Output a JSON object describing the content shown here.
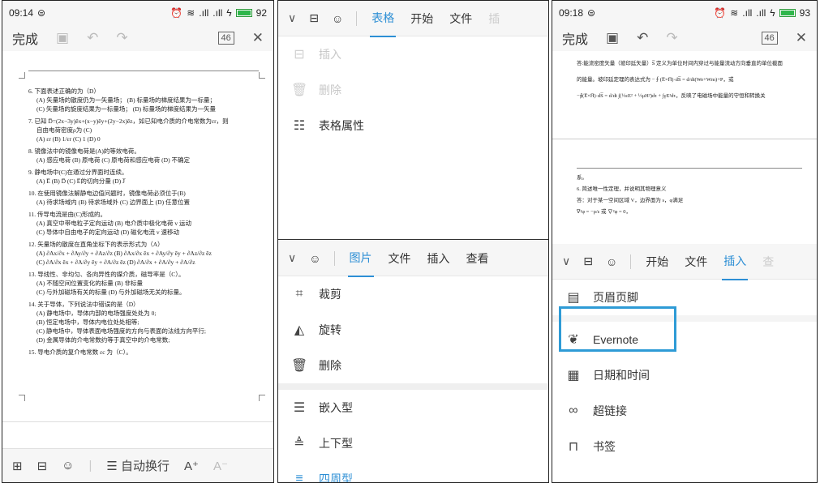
{
  "panel1": {
    "status": {
      "time": "09:14",
      "battery": "92",
      "battery_level": 0.92
    },
    "toolbar": {
      "done": "完成",
      "pages_badge": "46"
    },
    "doc": {
      "questions": [
        {
          "stem": "6. 下面表述正确的为（D）",
          "options": [
            "(A) 矢量场的散度仍为一矢量场；  (B) 标量场的梯度结果为一标量；",
            "(C) 矢量场的旋度结果为一标量场；  (D) 标量场的梯度结果为一矢量"
          ]
        },
        {
          "stem": "7. 已知 D̅=(2x−3y)ēx+(x−y)ēy+(2y−2x)ēz，如已知电介质的介电常数为εr，则",
          "options": [
            "自由电荷密度ρ为 (C)",
            "(A) εr      (B) 1/εr      (C) 1      (D) 0"
          ]
        },
        {
          "stem": "8. 镜像法中的镜像电荷是(A)的等效电荷。",
          "options": [
            "(A) 感应电荷   (B) 原电荷   (C) 原电荷和感应电荷   (D) 不确定"
          ]
        },
        {
          "stem": "9. 静电场中(C)在通过分界面时连续。",
          "options": [
            "(A) E̅     (B) D̅     (C) E̅的切向分量     (D) J̅"
          ]
        },
        {
          "stem": "10. 在使用镜像法解静电边值问题时，镜像电荷必须位于(B)",
          "options": [
            "(A) 待求场域内   (B) 待求场域外   (C) 边界面上   (D) 任意位置"
          ]
        },
        {
          "stem": "11. 传导电流是由(C)形成的。",
          "options": [
            "(A) 真空中带电粒子定向运动   (B) 电介质中极化电荷 v 运动",
            "(C) 导体中自由电子的定向运动   (D) 磁化电流 v 速移动"
          ]
        },
        {
          "stem": "12. 矢量场的散度在直角坐标下的表示形式为（A）",
          "options": [
            "(A) ∂Ax/∂x + ∂Ay/∂y + ∂Az/∂z      (B) ∂Ax/∂x ēx + ∂Ay/∂y ēy + ∂Az/∂z ēz",
            "(C) ∂A/∂x ēx + ∂A/∂y ēy + ∂A/∂z ēz      (D) ∂A/∂x + ∂A/∂y + ∂A/∂z"
          ]
        },
        {
          "stem": "13. 导线性、非均匀、各向异性的媒介质，磁导率是（C）。",
          "options": [
            "(A) 不随空间位置变化的标量      (B) 非标量",
            "(C) 与外加磁场有关的标量      (D) 与外加磁场无关的标量。"
          ]
        },
        {
          "stem": "14. 关于导体，下列说法中错误的是（D）",
          "options": [
            "(A) 静电场中，导体内部的电场强度处处为 0;",
            "(B) 恒定电场中，导体内电位处处相等;",
            "(C) 静电场中，导体表面电场强度的方向与表面的法线方向平行;",
            "(D) 金属导体的介电常数约等于真空中的介电常数;"
          ]
        },
        {
          "stem": "15. 导电介质的复介电常数 εc 为（C）。",
          "options": []
        }
      ]
    },
    "bottombar": {
      "wrap": "自动换行",
      "font_up": "A⁺",
      "font_down": "A⁻"
    }
  },
  "panel2": {
    "tabs_top": [
      "表格",
      "开始",
      "文件"
    ],
    "menu_top": [
      {
        "icon": "insert-icon",
        "label": "插入",
        "disabled": true
      },
      {
        "icon": "trash-icon",
        "label": "删除",
        "disabled": true
      },
      {
        "icon": "table-properties-icon",
        "label": "表格属性",
        "disabled": false
      }
    ],
    "tabs_bottom": [
      "图片",
      "文件",
      "插入",
      "查看"
    ],
    "menu_bottom": [
      {
        "icon": "crop-icon",
        "label": "裁剪"
      },
      {
        "icon": "rotate-icon",
        "label": "旋转"
      },
      {
        "icon": "trash-icon",
        "label": "删除"
      }
    ],
    "menu_wrap": [
      {
        "icon": "inline-icon",
        "label": "嵌入型"
      },
      {
        "icon": "top-bottom-icon",
        "label": "上下型"
      },
      {
        "icon": "square-wrap-icon",
        "label": "四周型"
      }
    ]
  },
  "panel3": {
    "status": {
      "time": "09:18",
      "battery": "93",
      "battery_level": 0.93
    },
    "toolbar": {
      "done": "完成",
      "pages_badge": "46"
    },
    "doc_lines": [
      "答:能流密度矢量（坡印廷矢量）S̅ 定义为单位时间内穿过与能量流动方向垂直的单位截面",
      "的能量。坡印廷定理的表达式为 −∮(E̅×H̅)·dS̅ = d/dt(We+Wm)+P，或",
      "−∮(E̅×H̅)·dS̅ = d/dt ∫(½εE² + ½μH²)dτ + ∫γE²dτ，反映了电磁场中能量的守恒和转换关"
    ],
    "doc_lines_2": [
      "系。",
      "6. 简述唯一性定理，并说明其物理意义",
      "答：对于某一空间区域 V，边界面为 s，φ满足",
      "∇²φ = −ρ/ε   或   ∇²φ = 0，"
    ],
    "tabs": [
      "开始",
      "文件",
      "插入"
    ],
    "menu": [
      {
        "icon": "header-footer-icon",
        "label": "页眉页脚"
      },
      {
        "icon": "evernote-icon",
        "label": "Evernote"
      },
      {
        "icon": "calendar-clock-icon",
        "label": "日期和时间"
      },
      {
        "icon": "link-icon",
        "label": "超链接"
      },
      {
        "icon": "bookmark-icon",
        "label": "书签"
      }
    ]
  }
}
